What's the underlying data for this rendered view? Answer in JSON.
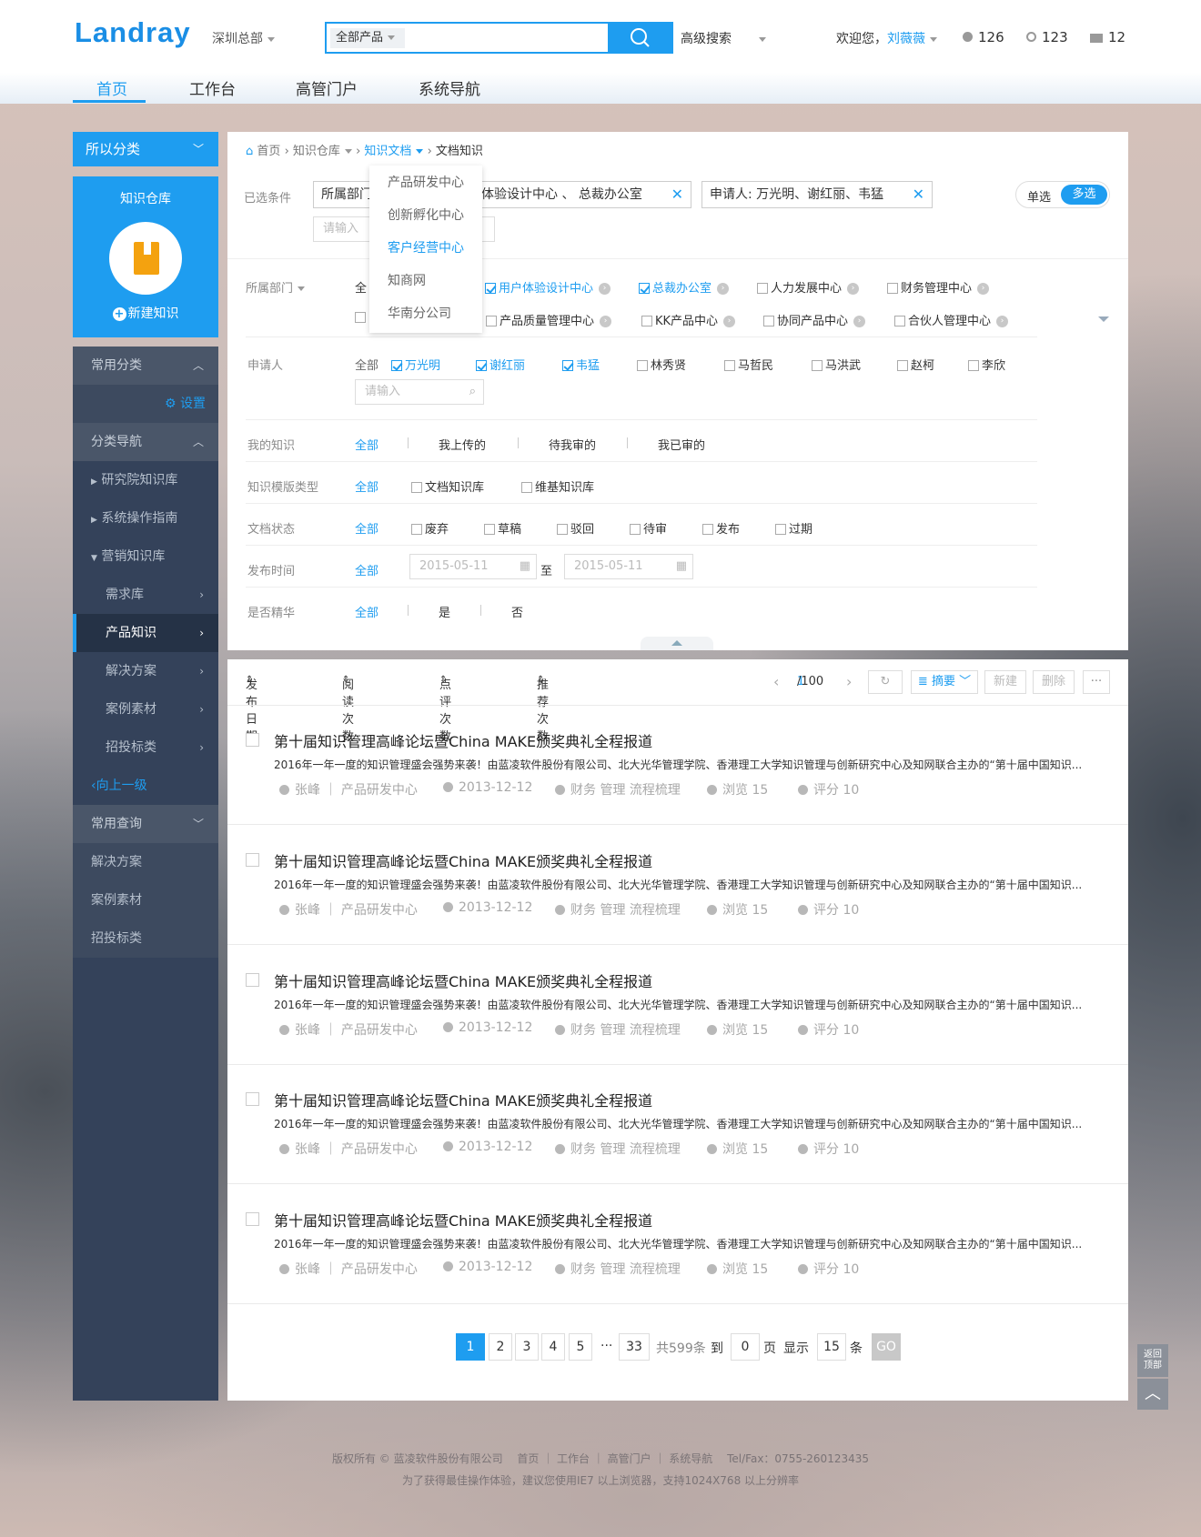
{
  "header": {
    "logo": "Landray",
    "hq": "深圳总部",
    "search_select": "全部产品",
    "advanced": "高级搜索",
    "welcome": "欢迎您，",
    "user": "刘薇薇",
    "count1": "126",
    "count2": "123",
    "count3": "12"
  },
  "nav": [
    "首页",
    "工作台",
    "高管门户",
    "系统导航"
  ],
  "left": {
    "category": "所以分类",
    "repo_title": "知识仓库",
    "new": "新建知识"
  },
  "sidebar": {
    "common": "常用分类",
    "settings": "设置",
    "nav": "分类导航",
    "items": [
      "研究院知识库",
      "系统操作指南",
      "营销知识库",
      "需求库",
      "产品知识",
      "解决方案",
      "案例素材",
      "招投标类"
    ],
    "back": "向上一级",
    "query": "常用查询",
    "query_items": [
      "解决方案",
      "案例素材",
      "招投标类"
    ]
  },
  "breadcrumb": {
    "home": "首页",
    "warehouse": "知识仓库",
    "docs": "知识文档",
    "current": "文档知识"
  },
  "dropdown": [
    "产品研发中心",
    "创新孵化中心",
    "客户经营中心",
    "知商网",
    "华南分公司"
  ],
  "selected": {
    "label": "已选条件",
    "tag1": "所属部门：用户体验设计中心 、 总裁办公室",
    "tag1_visible_a": "所属部门",
    "tag1_visible_b": "体验设计中心 、 总裁办公室",
    "tag2": "申请人: 万光明、谢红丽、韦猛",
    "input": "请输入",
    "single": "单选",
    "multi": "多选"
  },
  "filters": {
    "dept_label": "所属部门",
    "all": "全部",
    "all_short": "全",
    "dept_row1": [
      "用户体验设计中心",
      "总裁办公室",
      "人力发展中心",
      "财务管理中心"
    ],
    "dept_row2": [
      "产品质量管理中心",
      "KK产品中心",
      "协同产品中心",
      "合伙人管理中心"
    ],
    "applicant_label": "申请人",
    "applicants": [
      "万光明",
      "谢红丽",
      "韦猛",
      "林秀贤",
      "马哲民",
      "马洪武",
      "赵柯",
      "李欣"
    ],
    "applicant_input": "请输入",
    "mine_label": "我的知识",
    "mine": [
      "我上传的",
      "待我审的",
      "我已审的"
    ],
    "tpl_label": "知识模版类型",
    "tpl": [
      "文档知识库",
      "维基知识库"
    ],
    "status_label": "文档状态",
    "status": [
      "废弃",
      "草稿",
      "驳回",
      "待审",
      "发布",
      "过期"
    ],
    "time_label": "发布时间",
    "date_from": "2015-05-11",
    "to": "至",
    "date_to": "2015-05-11",
    "essence_label": "是否精华",
    "yes": "是",
    "no": "否"
  },
  "sort": {
    "items": [
      "发布日期",
      "阅读次数",
      "点评次数",
      "推荐次数"
    ],
    "page_cur": "1",
    "page_total": "/100",
    "view": "摘要",
    "new": "新建",
    "delete": "删除",
    "more": "···"
  },
  "articles": [
    {
      "title": "第十届知识管理高峰论坛暨China MAKE颁奖典礼全程报道",
      "summary": "2016年一年一度的知识管理盛会强势来袭！由蓝凌软件股份有限公司、北大光华管理学院、香港理工大学知识管理与创新研究中心及知网联合主办的“第十届中国知识...",
      "author": "张峰",
      "dept": "产品研发中心",
      "date": "2013-12-12",
      "tags": "财务 管理 流程梳理",
      "views": "浏览 15",
      "score": "评分 10"
    },
    {
      "title": "第十届知识管理高峰论坛暨China MAKE颁奖典礼全程报道",
      "summary": "2016年一年一度的知识管理盛会强势来袭！由蓝凌软件股份有限公司、北大光华管理学院、香港理工大学知识管理与创新研究中心及知网联合主办的“第十届中国知识...",
      "author": "张峰",
      "dept": "产品研发中心",
      "date": "2013-12-12",
      "tags": "财务 管理 流程梳理",
      "views": "浏览 15",
      "score": "评分 10"
    },
    {
      "title": "第十届知识管理高峰论坛暨China MAKE颁奖典礼全程报道",
      "summary": "2016年一年一度的知识管理盛会强势来袭！由蓝凌软件股份有限公司、北大光华管理学院、香港理工大学知识管理与创新研究中心及知网联合主办的“第十届中国知识...",
      "author": "张峰",
      "dept": "产品研发中心",
      "date": "2013-12-12",
      "tags": "财务 管理 流程梳理",
      "views": "浏览 15",
      "score": "评分 10"
    },
    {
      "title": "第十届知识管理高峰论坛暨China MAKE颁奖典礼全程报道",
      "summary": "2016年一年一度的知识管理盛会强势来袭！由蓝凌软件股份有限公司、北大光华管理学院、香港理工大学知识管理与创新研究中心及知网联合主办的“第十届中国知识...",
      "author": "张峰",
      "dept": "产品研发中心",
      "date": "2013-12-12",
      "tags": "财务 管理 流程梳理",
      "views": "浏览 15",
      "score": "评分 10"
    },
    {
      "title": "第十届知识管理高峰论坛暨China MAKE颁奖典礼全程报道",
      "summary": "2016年一年一度的知识管理盛会强势来袭！由蓝凌软件股份有限公司、北大光华管理学院、香港理工大学知识管理与创新研究中心及知网联合主办的“第十届中国知识...",
      "author": "张峰",
      "dept": "产品研发中心",
      "date": "2013-12-12",
      "tags": "财务 管理 流程梳理",
      "views": "浏览 15",
      "score": "评分 10"
    }
  ],
  "pagination": {
    "pages": [
      "1",
      "2",
      "3",
      "4",
      "5"
    ],
    "ellipsis": "···",
    "last": "33",
    "total": "共599条",
    "goto": "到",
    "page_input": "0",
    "page_unit": "页",
    "show": "显示",
    "size": "15",
    "size_unit": "条",
    "go": "GO"
  },
  "totop": {
    "label": "返回顶部"
  },
  "footer": {
    "line1": "版权所有 © 蓝凌软件股份有限公司　 首页 ｜ 工作台 ｜ 高管门户 ｜ 系统导航　 Tel/Fax：0755-260123435",
    "line2": "为了获得最佳操作体验，建议您使用IE7 以上浏览器，支持1024X768 以上分辨率"
  },
  "colors": {
    "accent": "#1e9df0",
    "sidebar": "#34425a"
  }
}
